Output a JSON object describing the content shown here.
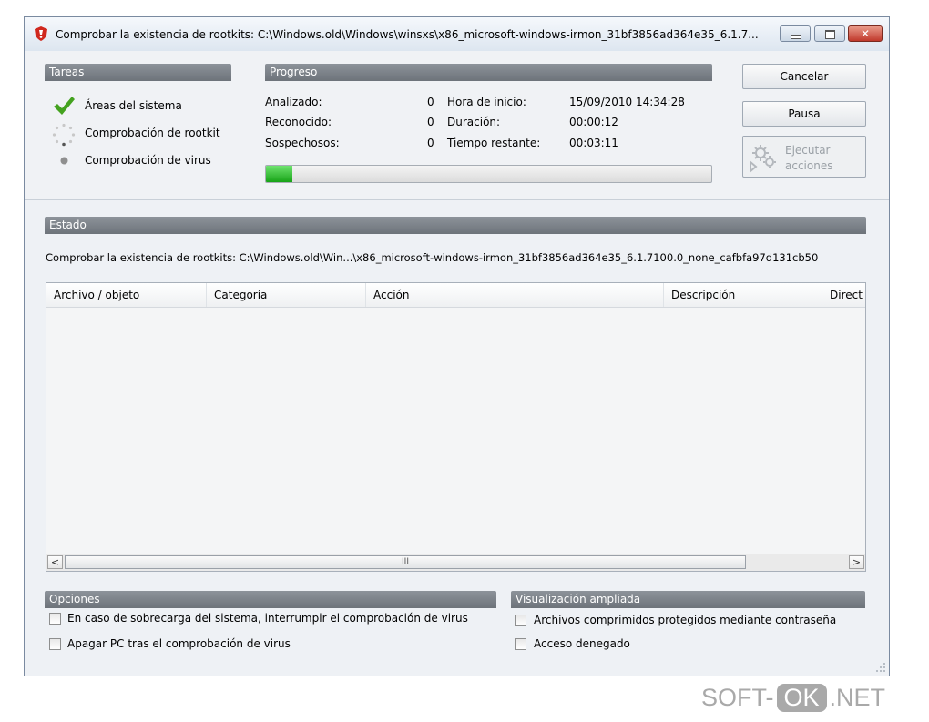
{
  "window": {
    "title": "Comprobar la existencia de rootkits: C:\\Windows.old\\Windows\\winsxs\\x86_microsoft-windows-irmon_31bf3856ad364e35_6.1.7...",
    "close_glyph": "✕"
  },
  "tasks": {
    "header": "Tareas",
    "items": [
      {
        "label": "Áreas del sistema",
        "icon": "checkmark-icon"
      },
      {
        "label": "Comprobación de rootkit",
        "icon": "spinner-icon"
      },
      {
        "label": "Comprobación de virus",
        "icon": "pending-dot-icon"
      }
    ]
  },
  "progress": {
    "header": "Progreso",
    "stats": [
      {
        "label": "Analizado:",
        "value": "0"
      },
      {
        "label": "Reconocido:",
        "value": "0"
      },
      {
        "label": "Sospechosos:",
        "value": "0"
      }
    ],
    "times": [
      {
        "label": "Hora de inicio:",
        "value": "15/09/2010 14:34:28"
      },
      {
        "label": "Duración:",
        "value": "00:00:12"
      },
      {
        "label": "Tiempo restante:",
        "value": "00:03:11"
      }
    ],
    "percent": 6,
    "bar_color": "#17a317"
  },
  "buttons": {
    "cancel": "Cancelar",
    "pause": "Pausa",
    "run_line1": "Ejecutar",
    "run_line2": "acciones"
  },
  "status": {
    "header": "Estado",
    "text": "Comprobar la existencia de rootkits: C:\\Windows.old\\Win...\\x86_microsoft-windows-irmon_31bf3856ad364e35_6.1.7100.0_none_cafbfa97d131cb50"
  },
  "table": {
    "columns": [
      "Archivo / objeto",
      "Categoría",
      "Acción",
      "Descripción",
      "Direct"
    ],
    "scroll_left": "<",
    "scroll_right": ">",
    "scroll_grip": "III"
  },
  "options": {
    "header": "Opciones",
    "items": [
      {
        "label": "En caso de sobrecarga del sistema, interrumpir el comprobación de virus",
        "checked": false
      },
      {
        "label": "Apagar PC tras el comprobación de virus",
        "checked": false
      }
    ]
  },
  "extended": {
    "header": "Visualización ampliada",
    "items": [
      {
        "label": "Archivos comprimidos protegidos mediante contraseña",
        "checked": false
      },
      {
        "label": "Acceso denegado",
        "checked": false
      }
    ]
  },
  "watermark": {
    "left": "SOFT-",
    "mid": "OK",
    "right": ".NET"
  }
}
